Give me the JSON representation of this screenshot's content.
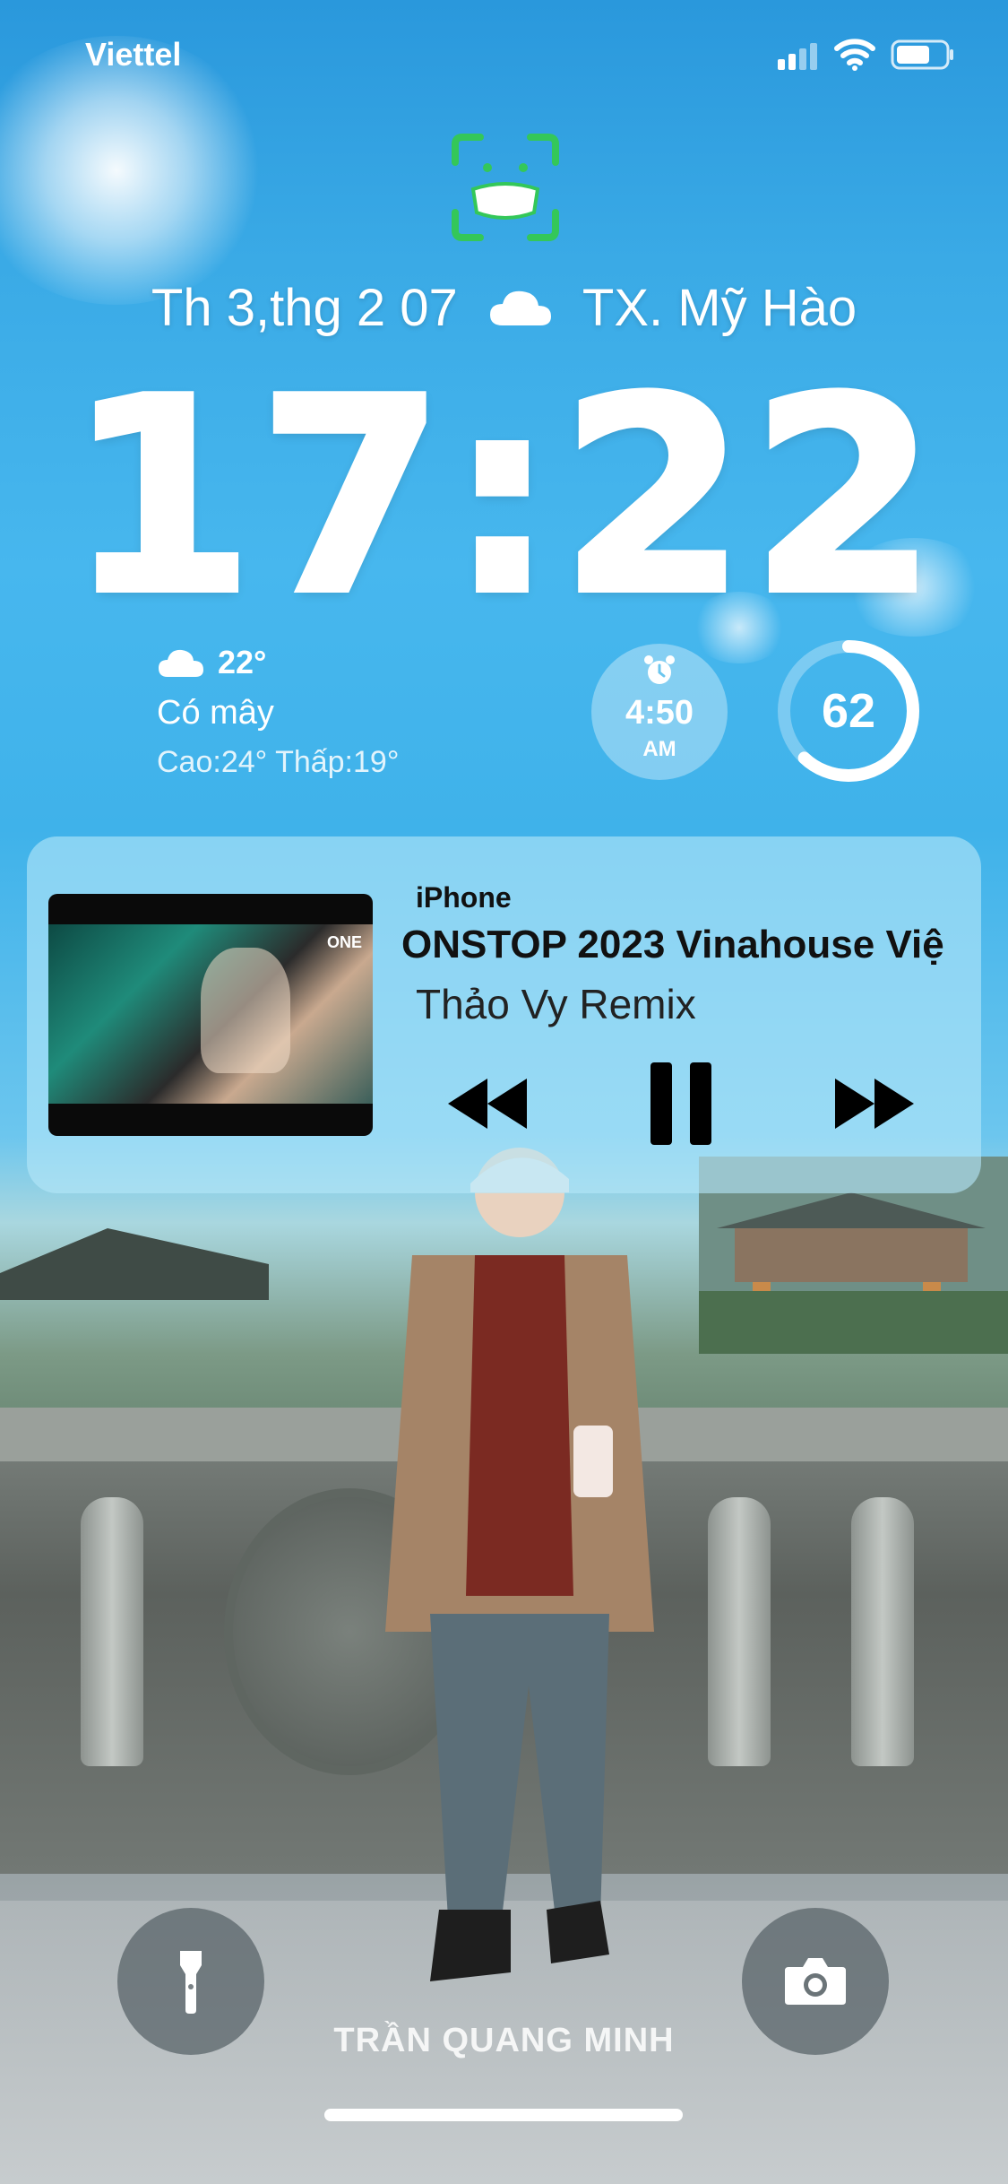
{
  "status_bar": {
    "carrier": "Viettel",
    "icons": [
      "signal-icon",
      "wifi-icon",
      "battery-icon"
    ]
  },
  "lock": {
    "face_id_icon": "face-id-mask-icon"
  },
  "date_line": {
    "date": "Th 3,thg 2 07",
    "location": "TX. Mỹ Hào",
    "icon": "cloud-icon"
  },
  "clock": {
    "time": "17:22"
  },
  "weather": {
    "temp": "22°",
    "condition": "Có mây",
    "hilo": "Cao:24° Thấp:19°"
  },
  "alarm": {
    "time": "4:50",
    "ampm": "AM",
    "icon": "alarm-clock-icon"
  },
  "battery_widget": {
    "level_text": "62",
    "level": 0.62
  },
  "now_playing": {
    "source": "iPhone",
    "title": "ONSTOP 2023 Vinahouse Việ",
    "artist": "Thảo Vy Remix",
    "artwork_logo": "ONE",
    "controls": [
      "rewind-icon",
      "pause-icon",
      "fast-forward-icon"
    ]
  },
  "wallpaper": {
    "credit": "TRẦN QUANG MINH"
  },
  "quick_actions": {
    "left": "flashlight-icon",
    "right": "camera-icon"
  },
  "colors": {
    "sky": "#3aaae6",
    "faceid": "#34c759",
    "media_card": "#b4e6f8"
  }
}
